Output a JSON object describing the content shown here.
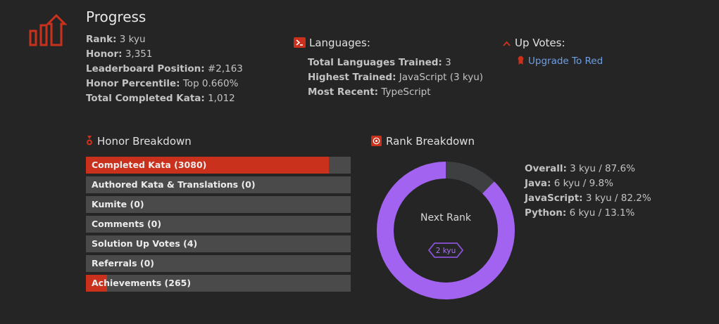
{
  "progress": {
    "title": "Progress",
    "icon": "progress-chart-icon",
    "stats": [
      {
        "label": "Rank:",
        "value": "3 kyu"
      },
      {
        "label": "Honor:",
        "value": "3,351"
      },
      {
        "label": "Leaderboard Position:",
        "value": "#2,163"
      },
      {
        "label": "Honor Percentile:",
        "value": "Top 0.660%"
      },
      {
        "label": "Total Completed Kata:",
        "value": "1,012"
      }
    ]
  },
  "languages": {
    "title": "Languages:",
    "icon": "terminal-icon",
    "stats": [
      {
        "label": "Total Languages Trained:",
        "value": "3"
      },
      {
        "label": "Highest Trained:",
        "value": "JavaScript (3 kyu)"
      },
      {
        "label": "Most Recent:",
        "value": "TypeScript"
      }
    ]
  },
  "up_votes": {
    "title": "Up Votes:",
    "icon": "chevron-up-icon",
    "upgrade_label": "Upgrade To Red",
    "upgrade_icon": "ribbon-icon"
  },
  "honor_breakdown": {
    "title": "Honor Breakdown",
    "icon": "medal-icon",
    "bars": [
      {
        "label": "Completed Kata (3080)",
        "fraction": 0.918
      },
      {
        "label": "Authored Kata & Translations (0)",
        "fraction": 0
      },
      {
        "label": "Kumite (0)",
        "fraction": 0
      },
      {
        "label": "Comments (0)",
        "fraction": 0
      },
      {
        "label": "Solution Up Votes (4)",
        "fraction": 0
      },
      {
        "label": "Referrals (0)",
        "fraction": 0
      },
      {
        "label": "Achievements (265)",
        "fraction": 0.079
      }
    ]
  },
  "rank_breakdown": {
    "title": "Rank Breakdown",
    "icon": "target-icon",
    "center_label": "Next Rank",
    "next_rank": "2 kyu",
    "progress": 0.876,
    "colors": {
      "fill": "#a263f0",
      "track": "#3d3f41"
    },
    "legend": [
      {
        "label": "Overall:",
        "value": "3 kyu / 87.6%"
      },
      {
        "label": "Java:",
        "value": "6 kyu / 9.8%"
      },
      {
        "label": "JavaScript:",
        "value": "3 kyu / 82.2%"
      },
      {
        "label": "Python:",
        "value": "6 kyu / 13.1%"
      }
    ]
  },
  "colors": {
    "accent": "#c9311c",
    "link": "#6f9fe0",
    "background": "#252526"
  }
}
